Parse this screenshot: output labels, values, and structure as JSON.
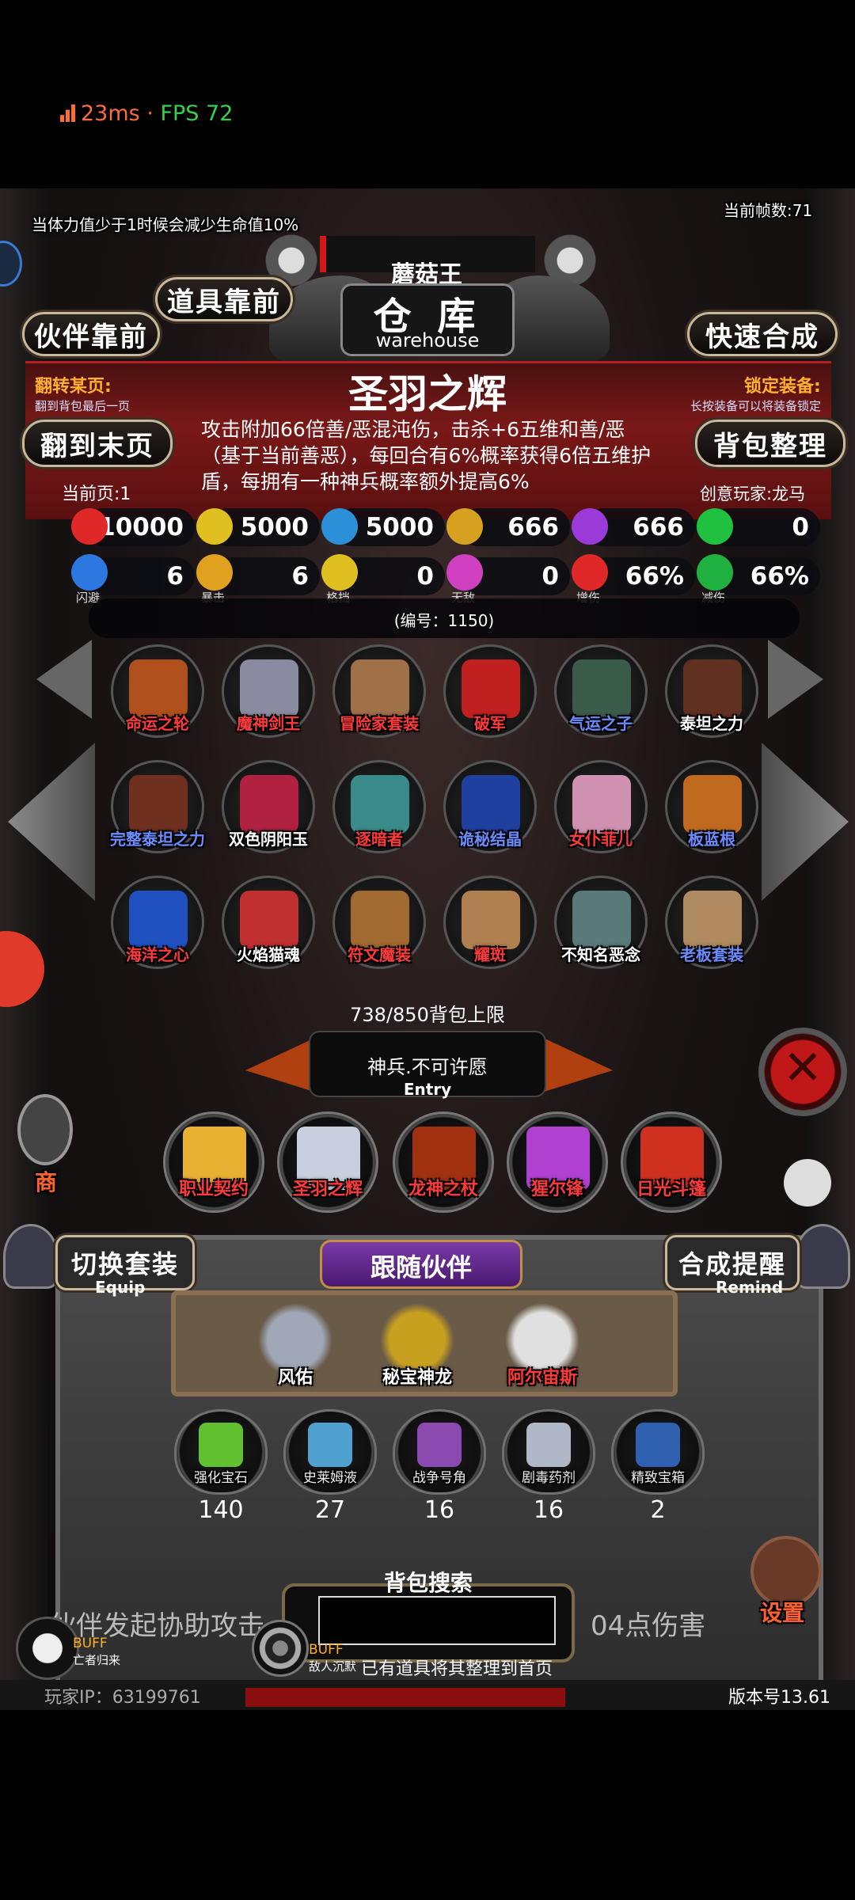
{
  "status": {
    "latency": "23ms",
    "separator": " · ",
    "fps": "FPS 72"
  },
  "hud": {
    "top_warning": "当体力值少于1时候会减少生命值10%",
    "frame_count": "当前帧数:71",
    "boss_name": "蘑菇王",
    "player_ip": "玩家IP：63199761",
    "version": "版本号13.61",
    "combat_text_left": "伙伴发起协助攻击",
    "combat_text_right": "04点伤害",
    "buff_left": "BUFF",
    "buff_left_sub": "亡者归来",
    "buff_mid": "BUFF",
    "buff_mid_sub": "敌人沉默",
    "sort_message": "已有道具将其整理到首页"
  },
  "warehouse": {
    "title_cn": "仓 库",
    "title_en": "warehouse",
    "btn_items_first": "道具靠前",
    "btn_partner_first": "伙伴靠前",
    "btn_quick_merge": "快速合成",
    "flip_hint_title": "翻转某页:",
    "flip_hint_sub": "翻到背包最后一页",
    "lock_title": "锁定装备:",
    "lock_sub": "长按装备可以将装备锁定",
    "btn_last_page": "翻到末页",
    "btn_bag_sort": "背包整理",
    "current_page": "当前页:1",
    "creator": "创意玩家:龙马"
  },
  "selected_item": {
    "name": "圣羽之辉",
    "description": "攻击附加66倍善/恶混沌伤，击杀+6五维和善/恶（基于当前善恶），每回合有6%概率获得6倍五维护盾，每拥有一种神兵概率额外提高6%",
    "serial": "(编号：1150)",
    "stats_row1": [
      {
        "icon": "heart-icon",
        "value": "10000",
        "color": "#e02828"
      },
      {
        "icon": "strength-icon",
        "value": "5000",
        "color": "#e0c020"
      },
      {
        "icon": "armor-icon",
        "value": "5000",
        "color": "#2c90d8"
      },
      {
        "icon": "sword-icon",
        "value": "666",
        "color": "#d8a020"
      },
      {
        "icon": "lightning-icon",
        "value": "666",
        "color": "#9a3ad8"
      },
      {
        "icon": "clover-icon",
        "value": "0",
        "color": "#20c040"
      }
    ],
    "stats_row2": [
      {
        "icon": "dodge-icon",
        "value": "6",
        "label": "闪避",
        "color": "#2c78e0"
      },
      {
        "icon": "crit-icon",
        "value": "6",
        "label": "暴击",
        "color": "#e0a020"
      },
      {
        "icon": "block-icon",
        "value": "0",
        "label": "格挡",
        "color": "#e0c020"
      },
      {
        "icon": "invincible-icon",
        "value": "0",
        "label": "无敌",
        "color": "#d040c0"
      },
      {
        "icon": "damage-up-icon",
        "value": "66%",
        "label": "增伤",
        "color": "#e02828"
      },
      {
        "icon": "damage-down-icon",
        "value": "66%",
        "label": "减伤",
        "color": "#20b040"
      }
    ]
  },
  "inventory": [
    {
      "name": "命运之轮",
      "color": "#ff3a3a",
      "art": "#b0501c"
    },
    {
      "name": "魔神剑王",
      "color": "#ff3a3a",
      "art": "#8a8aa0"
    },
    {
      "name": "冒险家套装",
      "color": "#ff3a3a",
      "art": "#a07048"
    },
    {
      "name": "破军",
      "color": "#ff3a3a",
      "art": "#c02020"
    },
    {
      "name": "气运之子",
      "color": "#6a8cff",
      "art": "#3a5a4a"
    },
    {
      "name": "泰坦之力",
      "color": "#ffffff",
      "art": "#603020"
    },
    {
      "name": "完整泰坦之力",
      "color": "#6a8cff",
      "art": "#703020"
    },
    {
      "name": "双色阴阳玉",
      "color": "#ffffff",
      "art": "#b02040"
    },
    {
      "name": "逐暗者",
      "color": "#ff3a3a",
      "art": "#3a8a8a"
    },
    {
      "name": "诡秘结晶",
      "color": "#6a8cff",
      "art": "#2040a0"
    },
    {
      "name": "女仆菲儿",
      "color": "#ff3a3a",
      "art": "#d090b0"
    },
    {
      "name": "板蓝根",
      "color": "#6a8cff",
      "art": "#c06a20"
    },
    {
      "name": "海洋之心",
      "color": "#ff3a3a",
      "art": "#2050c0"
    },
    {
      "name": "火焰猫魂",
      "color": "#ffffff",
      "art": "#c03030"
    },
    {
      "name": "符文魔装",
      "color": "#ff3a3a",
      "art": "#a06a30"
    },
    {
      "name": "耀斑",
      "color": "#ff3a3a",
      "art": "#b08050"
    },
    {
      "name": "不知名恶念",
      "color": "#ffffff",
      "art": "#5a7a7a"
    },
    {
      "name": "老板套装",
      "color": "#6a8cff",
      "art": "#b08a60"
    }
  ],
  "bag_limit": "738/850背包上限",
  "entry": {
    "title": "神兵.不可许愿",
    "subtitle": "Entry"
  },
  "equipped": [
    {
      "name": "职业契约",
      "art": "#e8b030"
    },
    {
      "name": "圣羽之辉",
      "art": "#c8d0e0"
    },
    {
      "name": "龙神之杖",
      "art": "#a03010"
    },
    {
      "name": "猩尔锋",
      "art": "#b040d0"
    },
    {
      "name": "日光斗篷",
      "art": "#d03020"
    }
  ],
  "loadout": {
    "btn_switch": "切换套装",
    "btn_switch_en": "Equip",
    "btn_remind": "合成提醒",
    "btn_remind_en": "Remind",
    "follow_title": "跟随伙伴"
  },
  "partners": [
    {
      "name": "风佑",
      "color": "#ffffff",
      "art": "#a0a8b8"
    },
    {
      "name": "秘宝神龙",
      "color": "#ffffff",
      "art": "#c8a020"
    },
    {
      "name": "阿尔宙斯",
      "color": "#ff3a3a",
      "art": "#e0e0e0"
    }
  ],
  "materials": [
    {
      "name": "强化宝石",
      "count": "140",
      "art": "#60c030"
    },
    {
      "name": "史莱姆液",
      "count": "27",
      "art": "#50a0d0"
    },
    {
      "name": "战争号角",
      "count": "16",
      "art": "#8a4ab0"
    },
    {
      "name": "剧毒药剂",
      "count": "16",
      "art": "#b0b8c8"
    },
    {
      "name": "精致宝箱",
      "count": "2",
      "art": "#3060b0"
    }
  ],
  "search": {
    "label": "背包搜索",
    "placeholder": ""
  },
  "side": {
    "shop": "商",
    "settings": "设置"
  }
}
